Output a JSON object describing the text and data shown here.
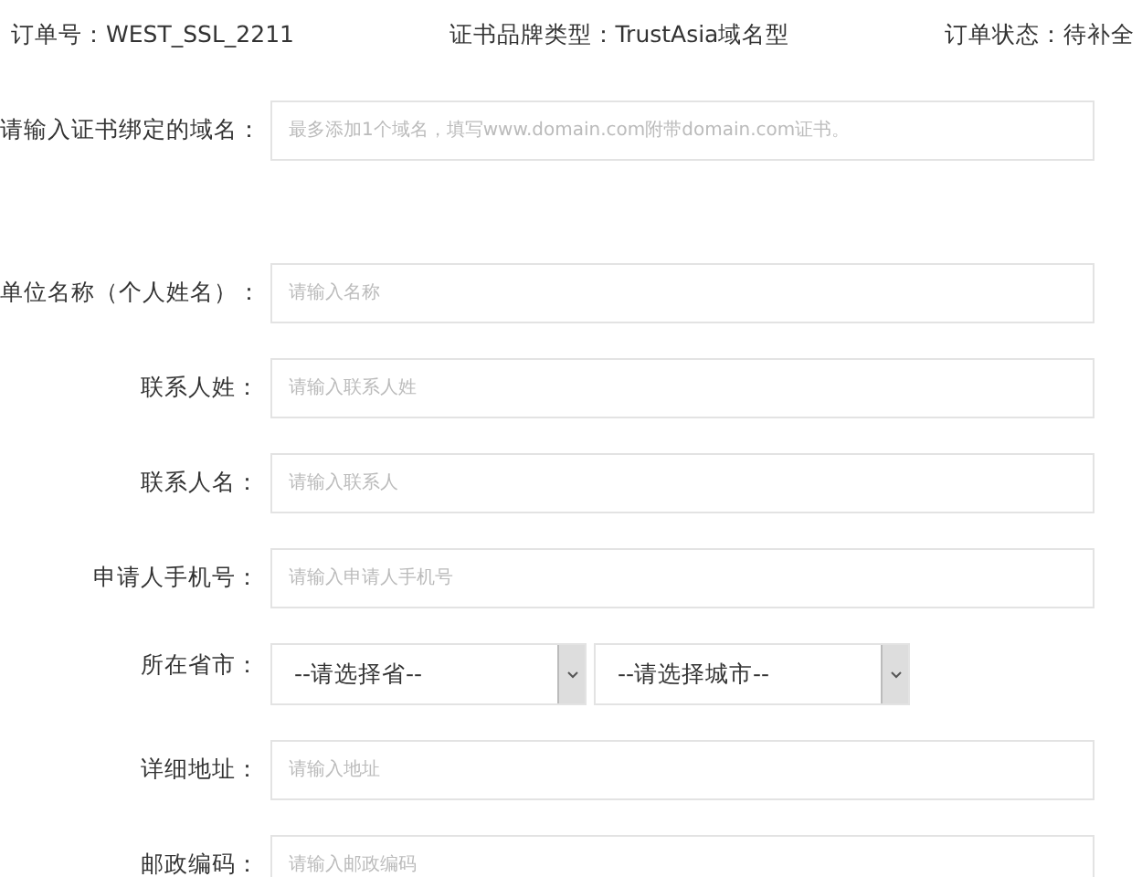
{
  "header": [
    {
      "label": "订单号：",
      "value": "WEST_SSL_2211"
    },
    {
      "label": "证书品牌类型：",
      "value": "TrustAsia域名型"
    },
    {
      "label": "订单状态：",
      "value": "待补全"
    }
  ],
  "form": [
    {
      "kind": "text",
      "label": "请输入证书绑定的域名：",
      "placeholder": "最多添加1个域名，填写www.domain.com附带domain.com证书。"
    },
    {
      "kind": "text",
      "label": "单位名称（个人姓名）：",
      "placeholder": "请输入名称"
    },
    {
      "kind": "text",
      "label": "联系人姓：",
      "placeholder": "请输入联系人姓"
    },
    {
      "kind": "text",
      "label": "联系人名：",
      "placeholder": "请输入联系人"
    },
    {
      "kind": "text",
      "label": "申请人手机号：",
      "placeholder": "请输入申请人手机号"
    },
    {
      "kind": "select",
      "label": "所在省市：",
      "selects": [
        "--请选择省--",
        "--请选择城市--"
      ]
    },
    {
      "kind": "text",
      "label": "详细地址：",
      "placeholder": "请输入地址"
    },
    {
      "kind": "text",
      "label": "邮政编码：",
      "placeholder": "请输入邮政编码"
    }
  ]
}
